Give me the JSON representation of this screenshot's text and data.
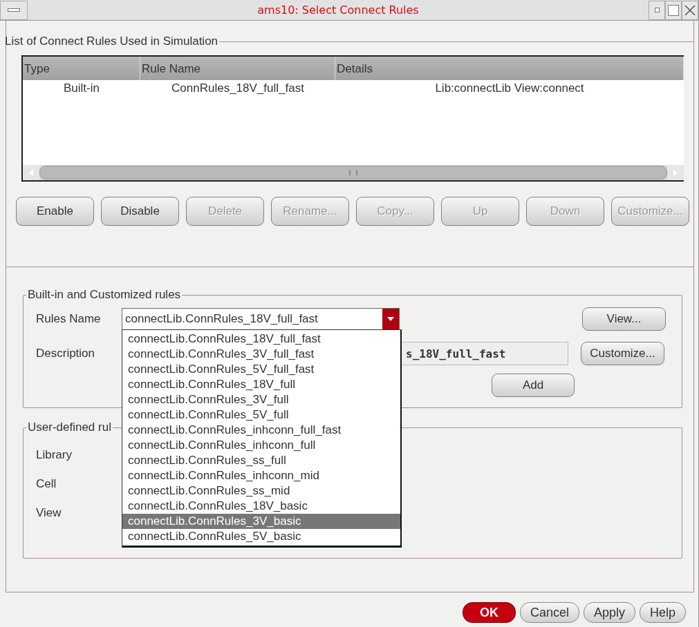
{
  "window": {
    "title": "ams10: Select Connect Rules"
  },
  "rules_used": {
    "title": "List of Connect Rules Used in Simulation",
    "columns": [
      "Type",
      "Rule Name",
      "Details"
    ],
    "rows": [
      [
        "Built-in",
        "ConnRules_18V_full_fast",
        "Lib:connectLib View:connect"
      ]
    ],
    "buttons": [
      {
        "label": "Enable",
        "disabled": false
      },
      {
        "label": "Disable",
        "disabled": false
      },
      {
        "label": "Delete",
        "disabled": true
      },
      {
        "label": "Rename...",
        "disabled": true
      },
      {
        "label": "Copy...",
        "disabled": true
      },
      {
        "label": "Up",
        "disabled": true
      },
      {
        "label": "Down",
        "disabled": true
      },
      {
        "label": "Customize...",
        "disabled": true
      }
    ]
  },
  "builtin": {
    "title": "Built-in and Customized rules",
    "rules_name_label": "Rules Name",
    "rules_name_value": "connectLib.ConnRules_18V_full_fast",
    "description_label": "Description",
    "description_value": "s_18V_full_fast",
    "view_button": "View...",
    "customize_button": "Customize...",
    "add_button": "Add",
    "dropdown": {
      "expanded": true,
      "options": [
        {
          "label": "connectLib.ConnRules_18V_full_fast",
          "selected": false
        },
        {
          "label": "connectLib.ConnRules_3V_full_fast",
          "selected": false
        },
        {
          "label": "connectLib.ConnRules_5V_full_fast",
          "selected": false
        },
        {
          "label": "connectLib.ConnRules_18V_full",
          "selected": false
        },
        {
          "label": "connectLib.ConnRules_3V_full",
          "selected": false
        },
        {
          "label": "connectLib.ConnRules_5V_full",
          "selected": false
        },
        {
          "label": "connectLib.ConnRules_inhconn_full_fast",
          "selected": false
        },
        {
          "label": "connectLib.ConnRules_inhconn_full",
          "selected": false
        },
        {
          "label": "connectLib.ConnRules_ss_full",
          "selected": false
        },
        {
          "label": "connectLib.ConnRules_inhconn_mid",
          "selected": false
        },
        {
          "label": "connectLib.ConnRules_ss_mid",
          "selected": false
        },
        {
          "label": "connectLib.ConnRules_18V_basic",
          "selected": false
        },
        {
          "label": "connectLib.ConnRules_3V_basic",
          "selected": true
        },
        {
          "label": "connectLib.ConnRules_5V_basic",
          "selected": false
        }
      ]
    }
  },
  "user_defined": {
    "title": "User-defined rul",
    "labels": [
      "Library",
      "Cell",
      "View"
    ]
  },
  "footer_buttons": [
    {
      "label": "OK",
      "kind": "default"
    },
    {
      "label": "Cancel",
      "kind": "normal"
    },
    {
      "label": "Apply",
      "kind": "normal"
    },
    {
      "label": "Help",
      "kind": "normal"
    }
  ]
}
